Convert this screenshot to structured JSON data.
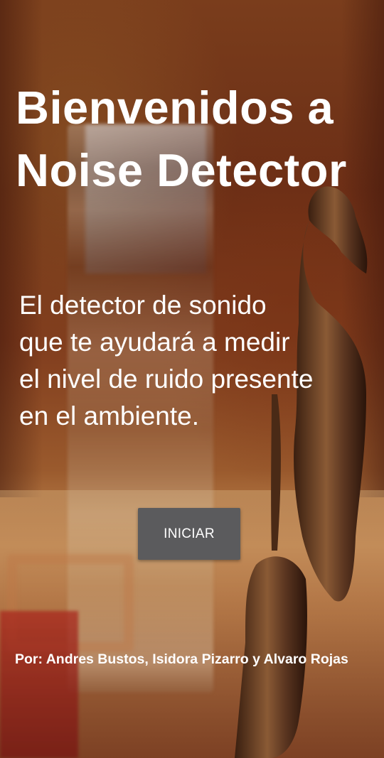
{
  "screen": {
    "title_lines": [
      "Bienvenidos a",
      "Noise Detector"
    ],
    "subtitle_lines": [
      "El detector de sonido",
      "que te ayudará a medir",
      "el nivel de ruido presente",
      "en el ambiente."
    ],
    "start_button_label": "INICIAR",
    "credits": "Por: Andres Bustos, Isidora Pizarro y Alvaro Rojas"
  },
  "colors": {
    "button_bg": "#5b5b5d",
    "text": "#ffffff"
  },
  "background": {
    "photo_icon": "library-bookstack-statue-photo"
  }
}
